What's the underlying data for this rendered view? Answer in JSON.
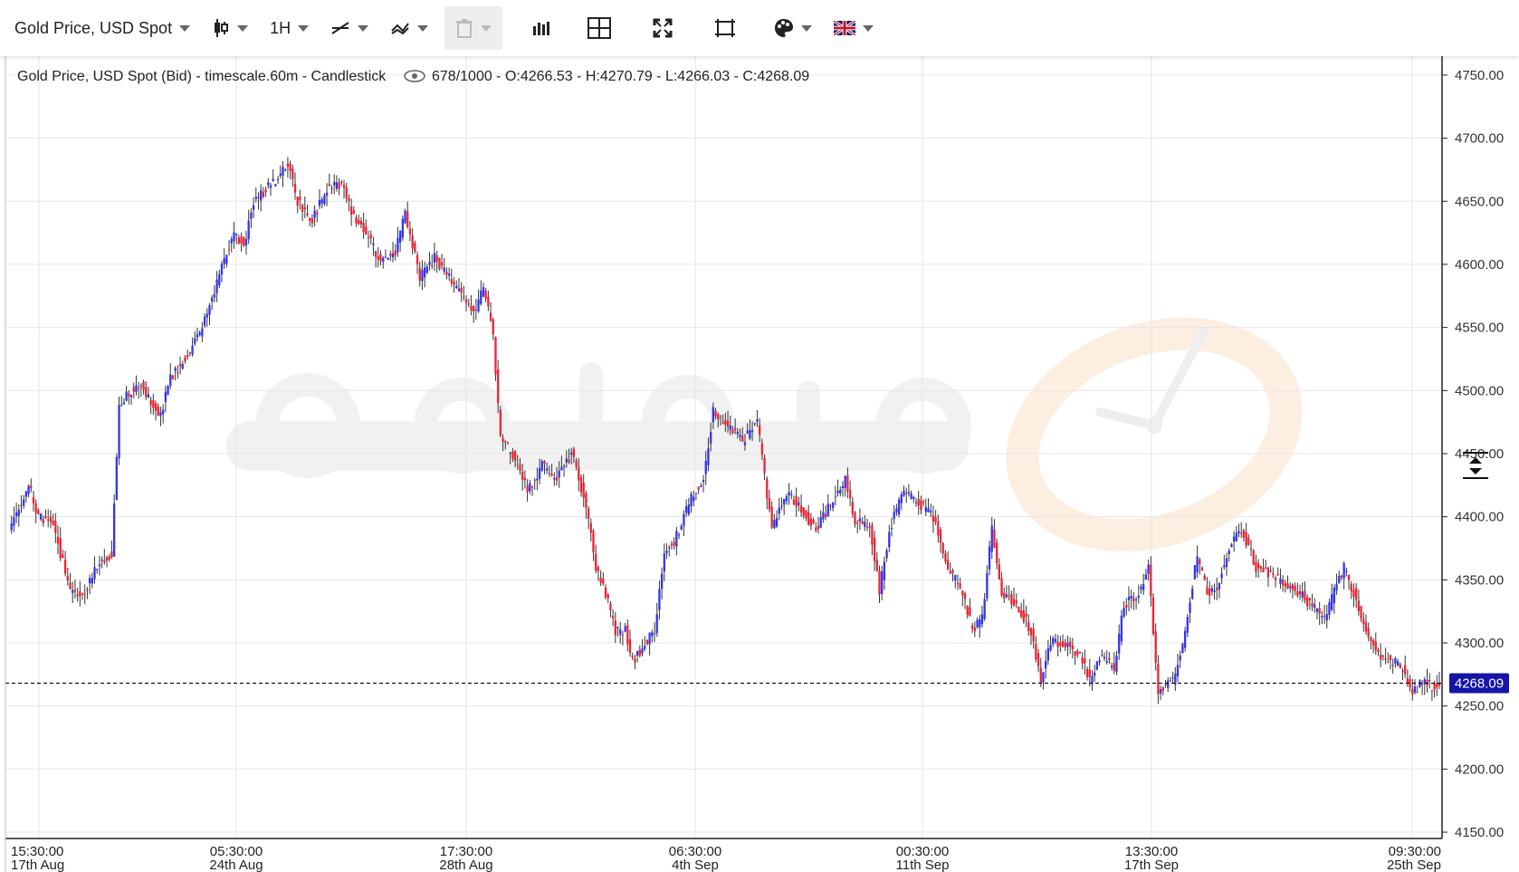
{
  "toolbar": {
    "symbol_label": "Gold Price, USD Spot",
    "timeframe_label": "1H",
    "icons": [
      "candlestick-icon",
      "line-tool-icon",
      "indicator-icon",
      "trash-icon",
      "bar-volume-icon",
      "crosshair-icon",
      "fullscreen-icon",
      "fit-screen-icon",
      "palette-icon",
      "uk-flag-icon"
    ]
  },
  "info": {
    "title": "Gold Price, USD Spot (Bid) - timescale.60m - Candlestick",
    "ohlc": "678/1000 - O:4266.53 - H:4270.79 - L:4266.03 - C:4268.09"
  },
  "colors": {
    "up": "#3333ee",
    "down": "#ee2233",
    "wick": "#333333",
    "grid": "#e6e6e6",
    "price_tag": "#1515a8",
    "watermark": "#e8e8e8",
    "watermark_accent": "#fbe3cf"
  },
  "chart_data": {
    "type": "candlestick",
    "y_ticks": [
      "4150.00",
      "4200.00",
      "4250.00",
      "4300.00",
      "4350.00",
      "4400.00",
      "4450.00",
      "4500.00",
      "4550.00",
      "4600.00",
      "4650.00",
      "4700.00",
      "4750.00"
    ],
    "ylim": [
      4145,
      4765
    ],
    "last_price": 4268.09,
    "last_price_label": "4268.09",
    "x_ticks": [
      {
        "time": "15:30:00",
        "date": "17th Aug"
      },
      {
        "time": "05:30:00",
        "date": "24th Aug"
      },
      {
        "time": "17:30:00",
        "date": "28th Aug"
      },
      {
        "time": "06:30:00",
        "date": "4th Sep"
      },
      {
        "time": "00:30:00",
        "date": "11th Sep"
      },
      {
        "time": "13:30:00",
        "date": "17th Sep"
      },
      {
        "time": "09:30:00",
        "date": "25th Sep"
      }
    ],
    "key_closes": [
      [
        0,
        4390
      ],
      [
        8,
        4425
      ],
      [
        12,
        4400
      ],
      [
        18,
        4395
      ],
      [
        25,
        4340
      ],
      [
        30,
        4335
      ],
      [
        37,
        4365
      ],
      [
        42,
        4370
      ],
      [
        45,
        4490
      ],
      [
        50,
        4500
      ],
      [
        54,
        4505
      ],
      [
        58,
        4490
      ],
      [
        62,
        4480
      ],
      [
        66,
        4510
      ],
      [
        70,
        4520
      ],
      [
        78,
        4545
      ],
      [
        84,
        4580
      ],
      [
        92,
        4625
      ],
      [
        96,
        4615
      ],
      [
        100,
        4650
      ],
      [
        108,
        4665
      ],
      [
        114,
        4680
      ],
      [
        118,
        4650
      ],
      [
        124,
        4635
      ],
      [
        130,
        4660
      ],
      [
        136,
        4665
      ],
      [
        140,
        4640
      ],
      [
        146,
        4625
      ],
      [
        152,
        4600
      ],
      [
        158,
        4610
      ],
      [
        162,
        4640
      ],
      [
        168,
        4590
      ],
      [
        174,
        4605
      ],
      [
        180,
        4590
      ],
      [
        186,
        4575
      ],
      [
        190,
        4560
      ],
      [
        194,
        4580
      ],
      [
        198,
        4545
      ],
      [
        201,
        4460
      ],
      [
        206,
        4450
      ],
      [
        212,
        4420
      ],
      [
        218,
        4440
      ],
      [
        224,
        4430
      ],
      [
        230,
        4450
      ],
      [
        236,
        4410
      ],
      [
        240,
        4360
      ],
      [
        244,
        4340
      ],
      [
        248,
        4310
      ],
      [
        252,
        4310
      ],
      [
        255,
        4285
      ],
      [
        260,
        4300
      ],
      [
        264,
        4310
      ],
      [
        268,
        4370
      ],
      [
        272,
        4380
      ],
      [
        276,
        4400
      ],
      [
        280,
        4420
      ],
      [
        284,
        4430
      ],
      [
        288,
        4485
      ],
      [
        294,
        4470
      ],
      [
        300,
        4460
      ],
      [
        306,
        4475
      ],
      [
        312,
        4390
      ],
      [
        318,
        4420
      ],
      [
        324,
        4405
      ],
      [
        330,
        4390
      ],
      [
        336,
        4410
      ],
      [
        342,
        4430
      ],
      [
        346,
        4395
      ],
      [
        352,
        4395
      ],
      [
        356,
        4340
      ],
      [
        360,
        4390
      ],
      [
        366,
        4420
      ],
      [
        372,
        4410
      ],
      [
        378,
        4400
      ],
      [
        384,
        4360
      ],
      [
        390,
        4340
      ],
      [
        394,
        4310
      ],
      [
        398,
        4320
      ],
      [
        402,
        4390
      ],
      [
        406,
        4340
      ],
      [
        412,
        4330
      ],
      [
        418,
        4310
      ],
      [
        422,
        4270
      ],
      [
        426,
        4300
      ],
      [
        432,
        4300
      ],
      [
        438,
        4290
      ],
      [
        442,
        4270
      ],
      [
        446,
        4290
      ],
      [
        452,
        4280
      ],
      [
        456,
        4330
      ],
      [
        462,
        4340
      ],
      [
        466,
        4360
      ],
      [
        470,
        4262
      ],
      [
        476,
        4270
      ],
      [
        480,
        4300
      ],
      [
        486,
        4370
      ],
      [
        490,
        4340
      ],
      [
        494,
        4345
      ],
      [
        500,
        4380
      ],
      [
        504,
        4390
      ],
      [
        510,
        4360
      ],
      [
        516,
        4355
      ],
      [
        522,
        4345
      ],
      [
        528,
        4340
      ],
      [
        532,
        4330
      ],
      [
        538,
        4320
      ],
      [
        542,
        4340
      ],
      [
        546,
        4360
      ],
      [
        550,
        4340
      ],
      [
        556,
        4305
      ],
      [
        560,
        4290
      ],
      [
        566,
        4285
      ],
      [
        570,
        4280
      ],
      [
        574,
        4260
      ],
      [
        578,
        4270
      ],
      [
        582,
        4265
      ],
      [
        585,
        4268
      ]
    ],
    "n_bars": 586
  }
}
